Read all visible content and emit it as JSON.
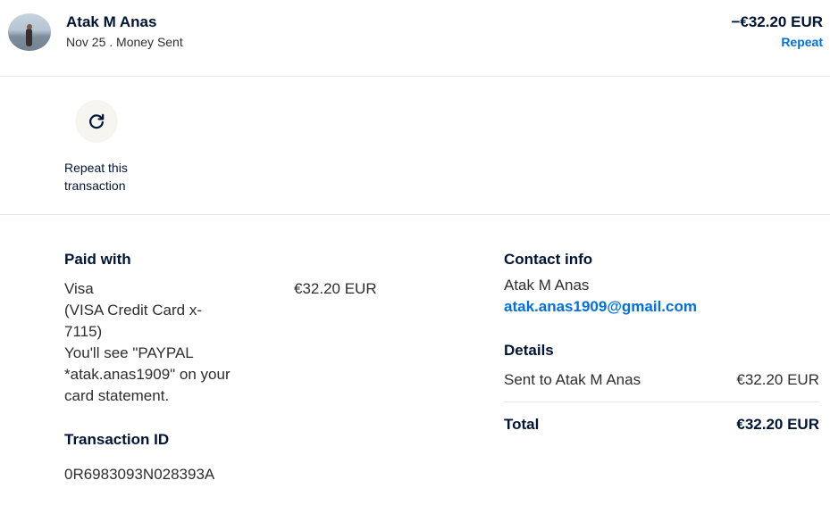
{
  "header": {
    "name": "Atak M Anas",
    "subline": "Nov 25 . Money Sent",
    "amount": "−€32.20 EUR",
    "repeat_label": "Repeat"
  },
  "repeat_section": {
    "icon": "refresh-icon",
    "caption": "Repeat this transaction"
  },
  "paid_with": {
    "heading": "Paid with",
    "card_lines": [
      "Visa",
      "(VISA Credit Card x-",
      "7115)",
      "You'll see \"PAYPAL",
      "*atak.anas1909\" on your",
      "card statement."
    ],
    "amount": "€32.20 EUR"
  },
  "transaction": {
    "heading": "Transaction ID",
    "id": "0R6983093N028393A"
  },
  "contact": {
    "heading": "Contact info",
    "name": "Atak M Anas",
    "email": "atak.anas1909@gmail.com"
  },
  "details": {
    "heading": "Details",
    "sent_label": "Sent to Atak M Anas",
    "sent_amount": "€32.20 EUR",
    "total_label": "Total",
    "total_amount": "€32.20 EUR"
  },
  "colors": {
    "primary_text": "#001435",
    "link": "#0070e0",
    "divider": "#e5e5e5",
    "repeat_bg": "#f7f5f0"
  }
}
